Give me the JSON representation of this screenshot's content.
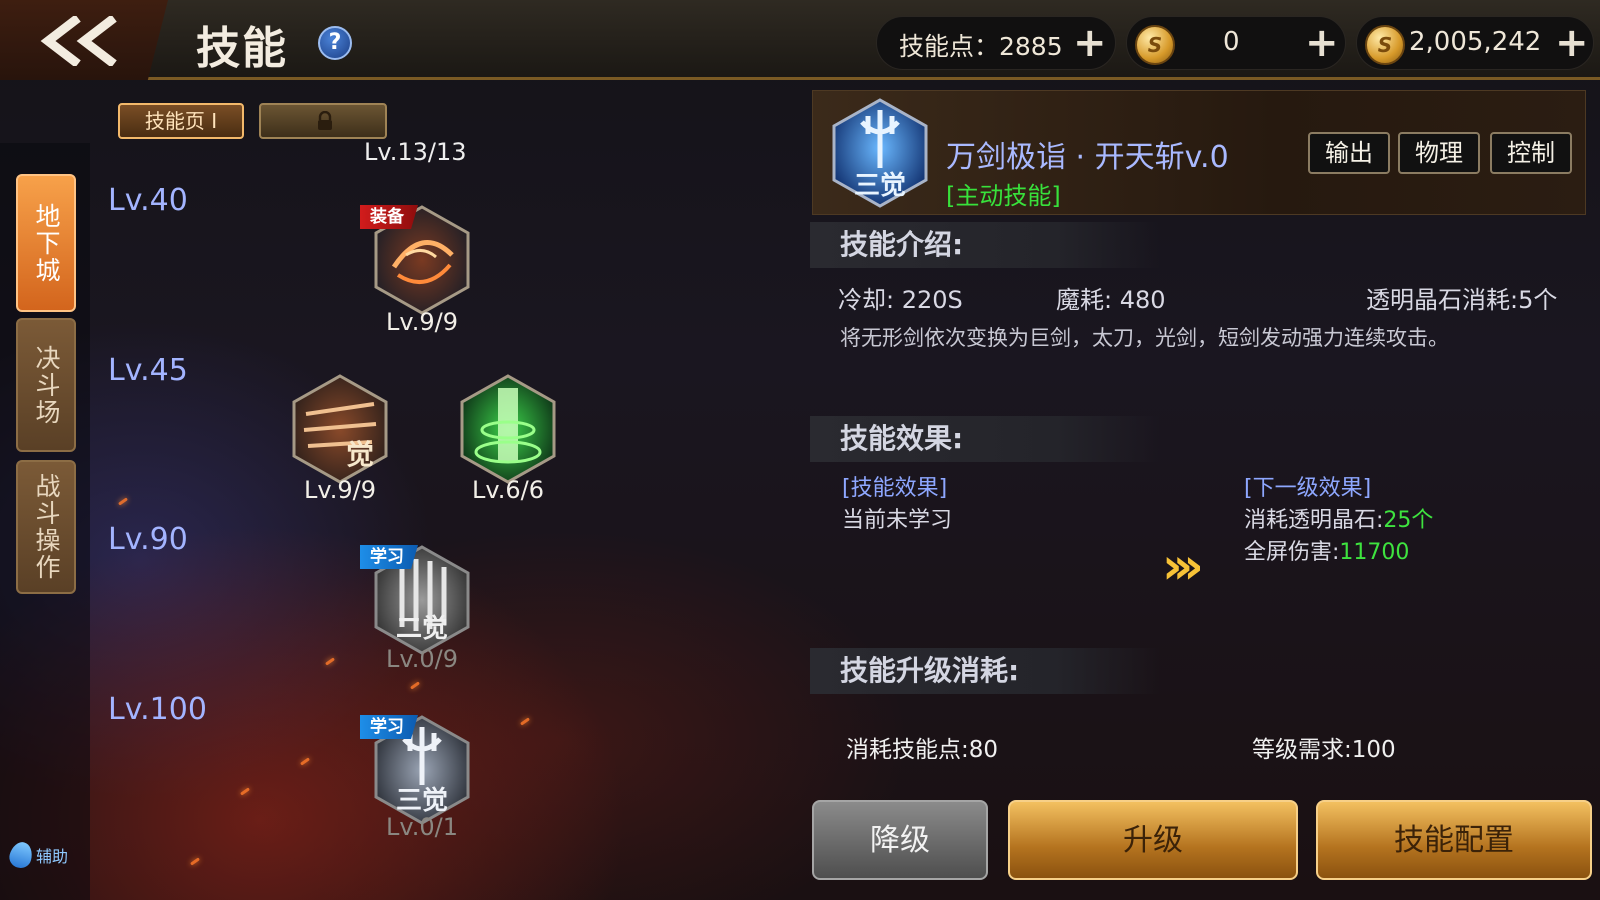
{
  "header": {
    "title": "技能",
    "help": "?",
    "skill_points_label": "技能点：2885",
    "coins_value": "0",
    "gold_value": "2,005,242",
    "plus": "+"
  },
  "side_tabs": [
    {
      "label": "地下城",
      "active": true
    },
    {
      "label": "决斗场",
      "active": false
    },
    {
      "label": "战斗操作",
      "active": false
    }
  ],
  "assist_label": "辅助",
  "skill_pages": {
    "page1": "技能页 I",
    "page2_locked": true
  },
  "tree": {
    "top_level": "Lv.13/13",
    "rows": [
      {
        "label": "Lv.40"
      },
      {
        "label": "Lv.45"
      },
      {
        "label": "Lv.90"
      },
      {
        "label": "Lv.100"
      }
    ],
    "skills": [
      {
        "id": "lv40",
        "level": "Lv.9/9",
        "badge": "装备"
      },
      {
        "id": "lv45a",
        "level": "Lv.9/9",
        "icon_text": "觉"
      },
      {
        "id": "lv45b",
        "level": "Lv.6/6"
      },
      {
        "id": "lv90",
        "level": "Lv.0/9",
        "badge": "学习",
        "icon_text": "二觉"
      },
      {
        "id": "lv100",
        "level": "Lv.0/1",
        "badge": "学习",
        "icon_text": "三觉"
      }
    ]
  },
  "detail": {
    "skill_name": "万剑极诣 · 开天斩v.0",
    "skill_type": "[主动技能]",
    "icon_text": "三觉",
    "tags": [
      "输出",
      "物理",
      "控制"
    ],
    "intro_head": "技能介绍:",
    "cooldown": "冷却: 220S",
    "mana": "魔耗: 480",
    "crystal": "透明晶石消耗:5个",
    "description": "将无形剑依次变换为巨剑，太刀，光剑，短剑发动强力连续攻击。",
    "effect_head": "技能效果:",
    "effect_current_title": "[技能效果]",
    "effect_current_text": "当前未学习",
    "effect_next_title": "[下一级效果]",
    "effect_next_crystal_label": "消耗透明晶石:",
    "effect_next_crystal_value": "25个",
    "effect_next_damage_label": "全屏伤害:",
    "effect_next_damage_value": "11700",
    "cost_head": "技能升级消耗:",
    "cost_points": "消耗技能点:80",
    "cost_level": "等级需求:100"
  },
  "buttons": {
    "downgrade": "降级",
    "upgrade": "升级",
    "config": "技能配置"
  },
  "colors": {
    "accent_orange": "#f7a14a",
    "green_value": "#3ee33f",
    "blue_text": "#8ea7ff",
    "gold_button": "#f3c060"
  }
}
